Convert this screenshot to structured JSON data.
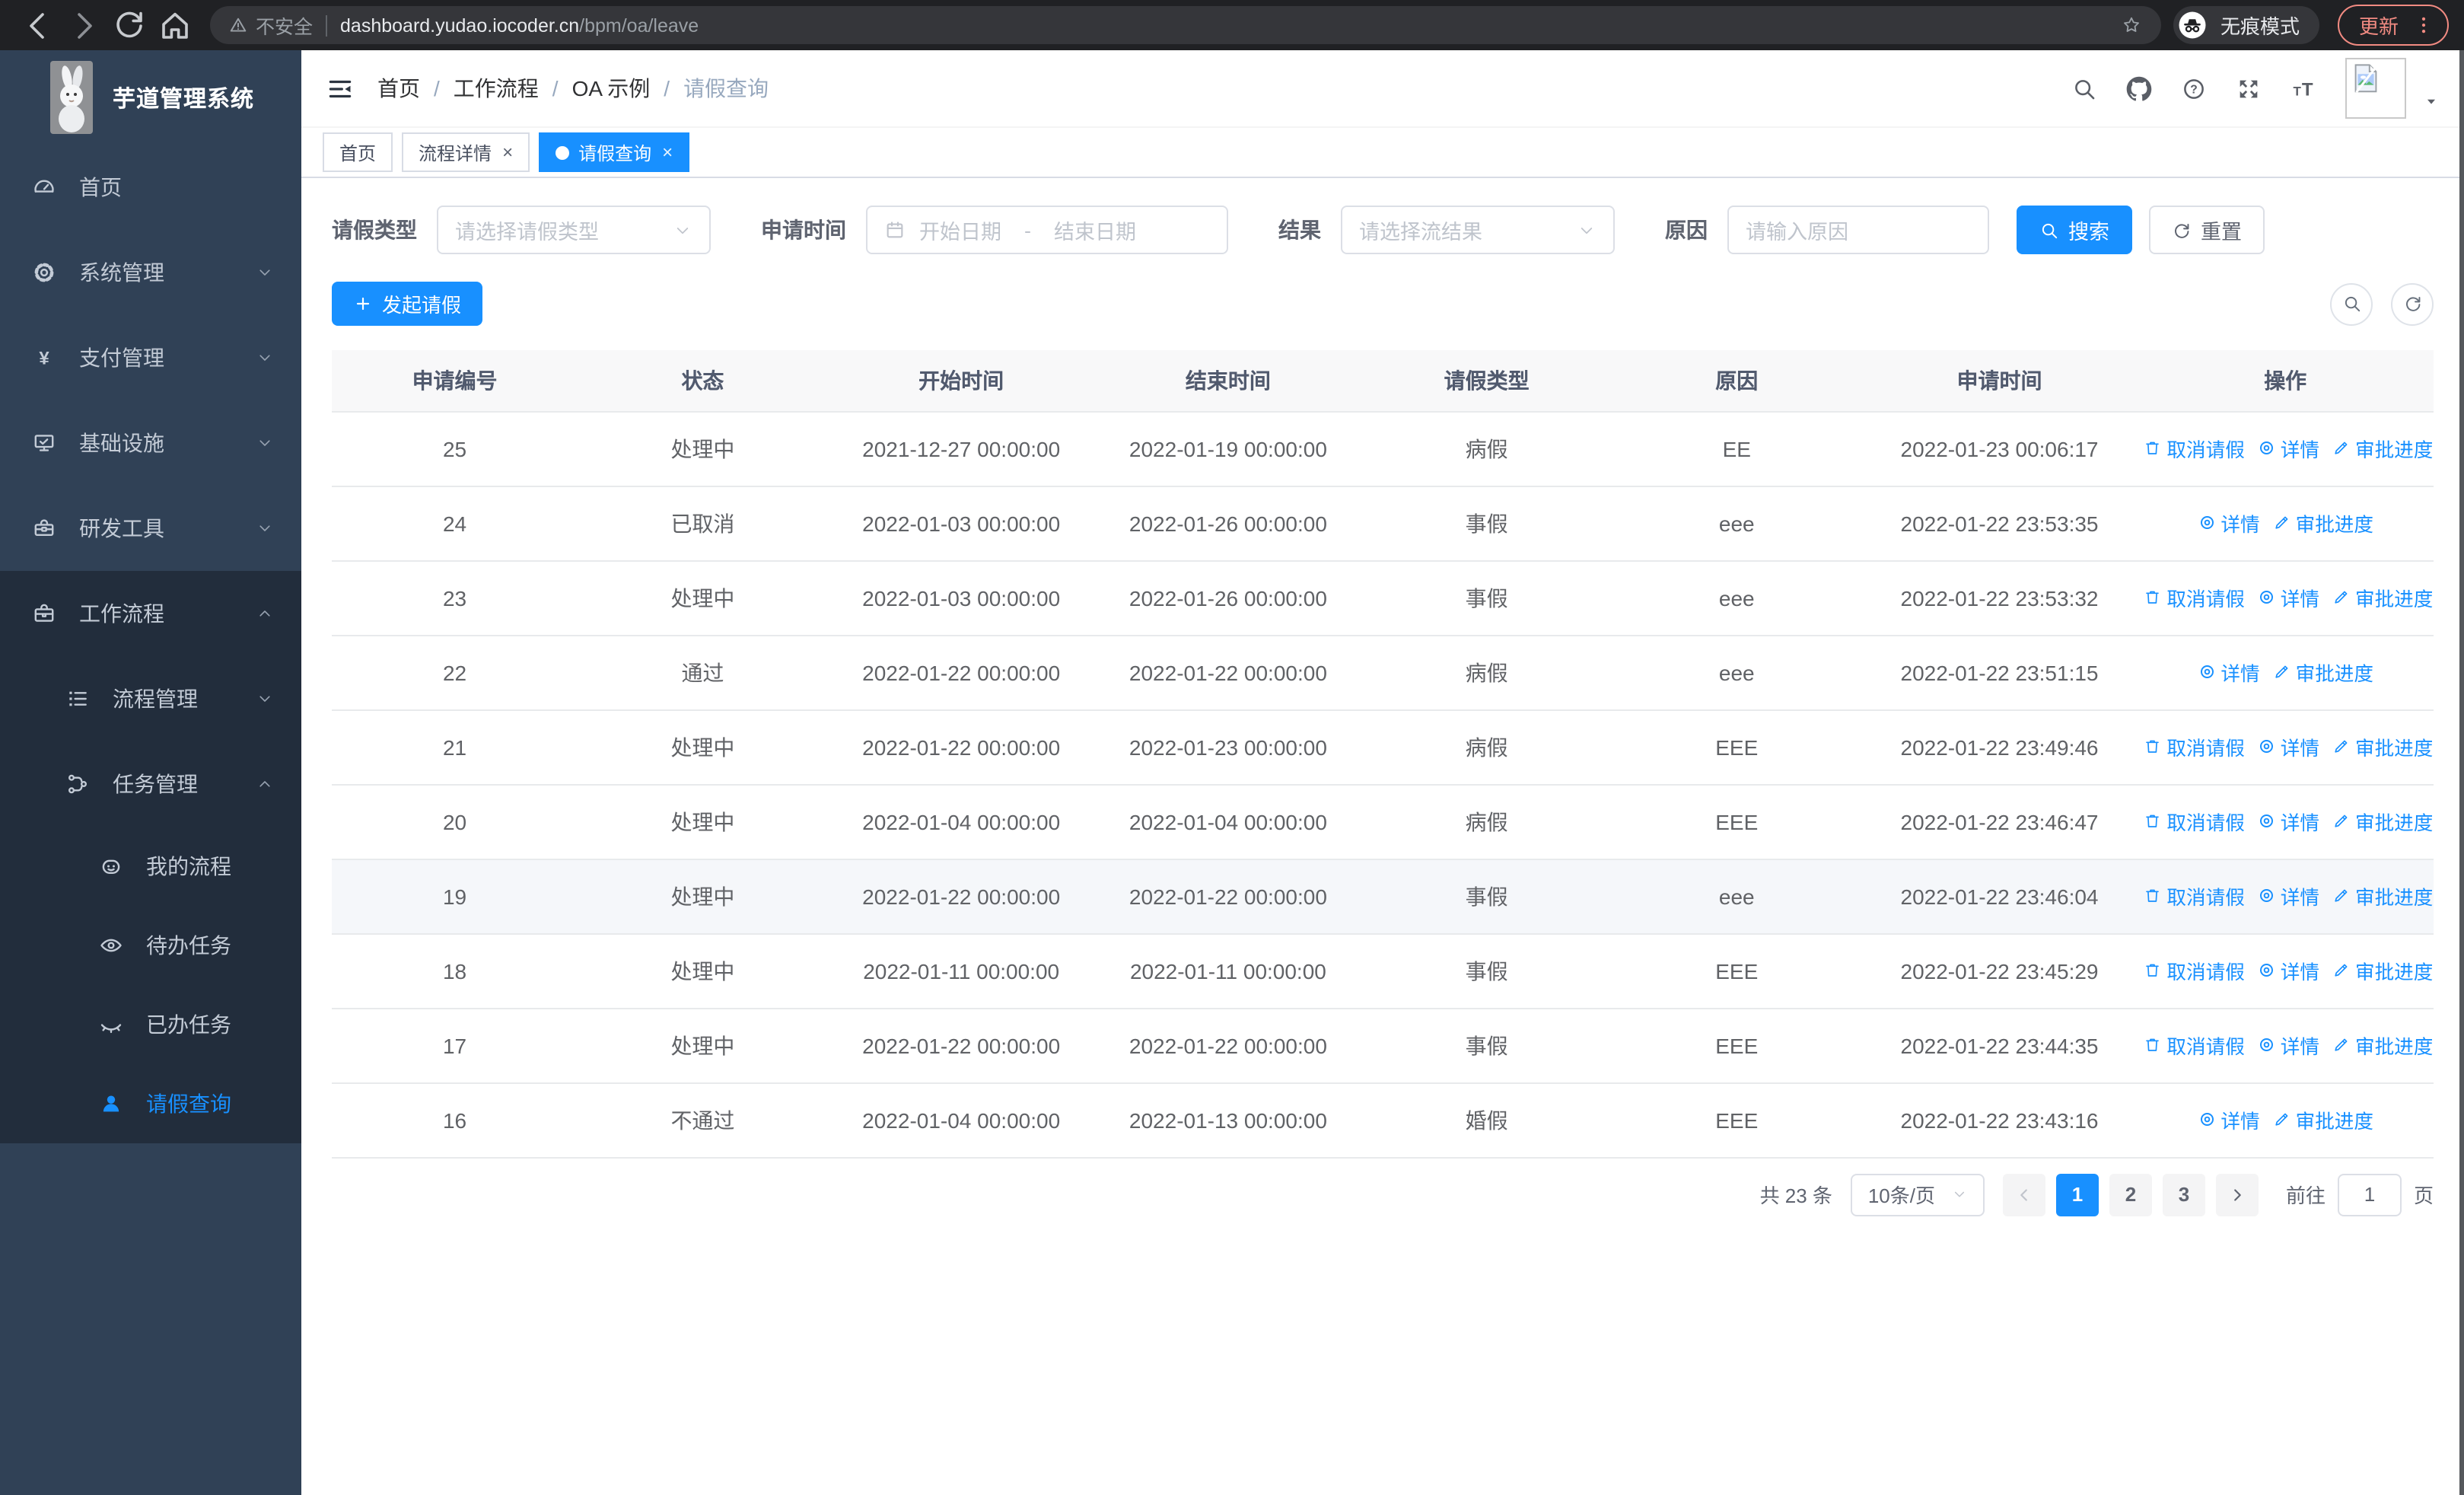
{
  "colors": {
    "accent": "#1890ff",
    "sidebar_bg": "#304156",
    "sidebar_dark_bg": "#222d3c",
    "update_accent": "#f28b82"
  },
  "browser": {
    "not_secure": "不安全",
    "url_host": "dashboard.yudao.iocoder.cn",
    "url_path": "/bpm/oa/leave",
    "incognito_label": "无痕模式",
    "update_label": "更新"
  },
  "app": {
    "title": "芋道管理系统"
  },
  "breadcrumb": {
    "separator": "/",
    "items": [
      "首页",
      "工作流程",
      "OA 示例",
      "请假查询"
    ]
  },
  "tabs": [
    {
      "id": "home",
      "label": "首页",
      "active": false,
      "closable": false
    },
    {
      "id": "process-detail",
      "label": "流程详情",
      "active": false,
      "closable": true
    },
    {
      "id": "leave-query",
      "label": "请假查询",
      "active": true,
      "closable": true
    }
  ],
  "sidebar": {
    "items": [
      {
        "id": "home",
        "icon": "gauge",
        "label": "首页",
        "level": 1,
        "chevron": "",
        "dark": false,
        "active": false
      },
      {
        "id": "system",
        "icon": "gear",
        "label": "系统管理",
        "level": 1,
        "chevron": "down",
        "dark": false,
        "active": false
      },
      {
        "id": "payment",
        "icon": "yen",
        "label": "支付管理",
        "level": 1,
        "chevron": "down",
        "dark": false,
        "active": false
      },
      {
        "id": "infra",
        "icon": "monitor",
        "label": "基础设施",
        "level": 1,
        "chevron": "down",
        "dark": false,
        "active": false
      },
      {
        "id": "dev-tools",
        "icon": "toolbox",
        "label": "研发工具",
        "level": 1,
        "chevron": "down",
        "dark": false,
        "active": false
      },
      {
        "id": "workflow",
        "icon": "briefcase",
        "label": "工作流程",
        "level": 1,
        "chevron": "up",
        "dark": true,
        "active": false
      },
      {
        "id": "process-mgmt",
        "icon": "list",
        "label": "流程管理",
        "level": 2,
        "chevron": "down",
        "dark": true,
        "active": false
      },
      {
        "id": "task-mgmt",
        "icon": "branch",
        "label": "任务管理",
        "level": 2,
        "chevron": "up",
        "dark": true,
        "active": false
      },
      {
        "id": "my-process",
        "icon": "face",
        "label": "我的流程",
        "level": 3,
        "chevron": "",
        "dark": true,
        "active": false
      },
      {
        "id": "todo-tasks",
        "icon": "eye",
        "label": "待办任务",
        "level": 3,
        "chevron": "",
        "dark": true,
        "active": false
      },
      {
        "id": "done-tasks",
        "icon": "eyeclosed",
        "label": "已办任务",
        "level": 3,
        "chevron": "",
        "dark": true,
        "active": false
      },
      {
        "id": "leave-query",
        "icon": "user",
        "label": "请假查询",
        "level": 3,
        "chevron": "",
        "dark": true,
        "active": true
      }
    ]
  },
  "filters": {
    "leave_type": {
      "label": "请假类型",
      "placeholder": "请选择请假类型"
    },
    "apply_time": {
      "label": "申请时间",
      "start_placeholder": "开始日期",
      "separator": "-",
      "end_placeholder": "结束日期"
    },
    "result": {
      "label": "结果",
      "placeholder": "请选择流结果"
    },
    "reason": {
      "label": "原因",
      "placeholder": "请输入原因"
    },
    "search_label": "搜索",
    "reset_label": "重置"
  },
  "toolbar": {
    "create_label": "发起请假"
  },
  "table": {
    "columns": [
      "申请编号",
      "状态",
      "开始时间",
      "结束时间",
      "请假类型",
      "原因",
      "申请时间",
      "操作"
    ],
    "action_labels": {
      "cancel": "取消请假",
      "detail": "详情",
      "progress": "审批进度"
    },
    "rows": [
      {
        "no": "25",
        "status": "处理中",
        "start": "2021-12-27 00:00:00",
        "end": "2022-01-19 00:00:00",
        "type": "病假",
        "reason": "EE",
        "applied": "2022-01-23 00:06:17",
        "actions": [
          "cancel",
          "detail",
          "progress"
        ],
        "highlight": false
      },
      {
        "no": "24",
        "status": "已取消",
        "start": "2022-01-03 00:00:00",
        "end": "2022-01-26 00:00:00",
        "type": "事假",
        "reason": "eee",
        "applied": "2022-01-22 23:53:35",
        "actions": [
          "detail",
          "progress"
        ],
        "highlight": false
      },
      {
        "no": "23",
        "status": "处理中",
        "start": "2022-01-03 00:00:00",
        "end": "2022-01-26 00:00:00",
        "type": "事假",
        "reason": "eee",
        "applied": "2022-01-22 23:53:32",
        "actions": [
          "cancel",
          "detail",
          "progress"
        ],
        "highlight": false
      },
      {
        "no": "22",
        "status": "通过",
        "start": "2022-01-22 00:00:00",
        "end": "2022-01-22 00:00:00",
        "type": "病假",
        "reason": "eee",
        "applied": "2022-01-22 23:51:15",
        "actions": [
          "detail",
          "progress"
        ],
        "highlight": false
      },
      {
        "no": "21",
        "status": "处理中",
        "start": "2022-01-22 00:00:00",
        "end": "2022-01-23 00:00:00",
        "type": "病假",
        "reason": "EEE",
        "applied": "2022-01-22 23:49:46",
        "actions": [
          "cancel",
          "detail",
          "progress"
        ],
        "highlight": false
      },
      {
        "no": "20",
        "status": "处理中",
        "start": "2022-01-04 00:00:00",
        "end": "2022-01-04 00:00:00",
        "type": "病假",
        "reason": "EEE",
        "applied": "2022-01-22 23:46:47",
        "actions": [
          "cancel",
          "detail",
          "progress"
        ],
        "highlight": false
      },
      {
        "no": "19",
        "status": "处理中",
        "start": "2022-01-22 00:00:00",
        "end": "2022-01-22 00:00:00",
        "type": "事假",
        "reason": "eee",
        "applied": "2022-01-22 23:46:04",
        "actions": [
          "cancel",
          "detail",
          "progress"
        ],
        "highlight": true
      },
      {
        "no": "18",
        "status": "处理中",
        "start": "2022-01-11 00:00:00",
        "end": "2022-01-11 00:00:00",
        "type": "事假",
        "reason": "EEE",
        "applied": "2022-01-22 23:45:29",
        "actions": [
          "cancel",
          "detail",
          "progress"
        ],
        "highlight": false
      },
      {
        "no": "17",
        "status": "处理中",
        "start": "2022-01-22 00:00:00",
        "end": "2022-01-22 00:00:00",
        "type": "事假",
        "reason": "EEE",
        "applied": "2022-01-22 23:44:35",
        "actions": [
          "cancel",
          "detail",
          "progress"
        ],
        "highlight": false
      },
      {
        "no": "16",
        "status": "不通过",
        "start": "2022-01-04 00:00:00",
        "end": "2022-01-13 00:00:00",
        "type": "婚假",
        "reason": "EEE",
        "applied": "2022-01-22 23:43:16",
        "actions": [
          "detail",
          "progress"
        ],
        "highlight": false
      }
    ]
  },
  "pagination": {
    "total": "共 23 条",
    "page_size": "10条/页",
    "pages": [
      "1",
      "2",
      "3"
    ],
    "active_page": "1",
    "goto_label": "前往",
    "goto_value": "1",
    "page_unit": "页"
  }
}
